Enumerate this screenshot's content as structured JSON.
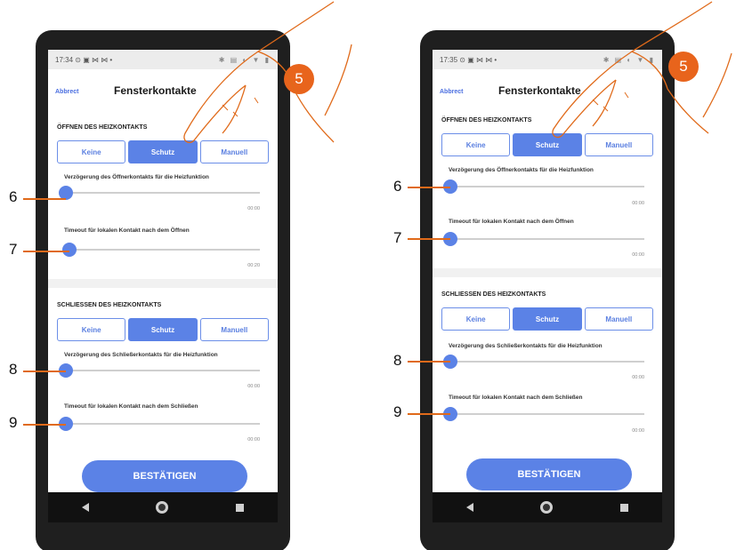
{
  "screens": [
    {
      "time": "17:34",
      "status_icons": "⊙ ▣ ⋈ ⋈ •",
      "status_right": "✱ ▤ ◐ ▼ ▮",
      "cancel": "Abbrect",
      "title": "Fensterkontakte",
      "open_section": "ÖFFNEN DES HEIZKONTAKTS",
      "open_buttons": [
        "Keine",
        "Schutz",
        "Manuell"
      ],
      "open_active": "Schutz",
      "slider1_label": "Verzögerung des Öffnerkontakts für die Heizfunktion",
      "slider1_value": "00:00",
      "slider2_label": "Timeout für lokalen Kontakt nach dem Öffnen",
      "slider2_value": "00:20",
      "close_section": "SCHLIESSEN DES HEIZKONTAKTS",
      "close_buttons": [
        "Keine",
        "Schutz",
        "Manuell"
      ],
      "close_active": "Schutz",
      "slider3_label": "Verzögerung des Schließerkontakts für die Heizfunktion",
      "slider3_value": "00:00",
      "slider4_label": "Timeout für lokalen Kontakt nach dem Schließen",
      "slider4_value": "00:00",
      "confirm": "BESTÄTIGEN"
    },
    {
      "time": "17:35",
      "status_icons": "⊙ ▣ ⋈ ⋈ •",
      "status_right": "✱ ▤ ◐ ▼ ▮",
      "cancel": "Abbrect",
      "title": "Fensterkontakte",
      "open_section": "ÖFFNEN DES HEIZKONTAKTS",
      "open_buttons": [
        "Keine",
        "Schutz",
        "Manuell"
      ],
      "open_active": "Schutz",
      "slider1_label": "Verzögerung des Öffnerkontakts für die Heizfunktion",
      "slider1_value": "00:00",
      "slider2_label": "Timeout für lokalen Kontakt nach dem Öffnen",
      "slider2_value": "00:00",
      "close_section": "SCHLIESSEN DES HEIZKONTAKTS",
      "close_buttons": [
        "Keine",
        "Schutz",
        "Manuell"
      ],
      "close_active": "Schutz",
      "slider3_label": "Verzögerung des Schließerkontakts für die Heizfunktion",
      "slider3_value": "00:00",
      "slider4_label": "Timeout für lokalen Kontakt nach dem Schließen",
      "slider4_value": "00:00",
      "confirm": "BESTÄTIGEN"
    }
  ],
  "callouts": {
    "left": [
      "6",
      "7",
      "8",
      "9"
    ],
    "right": [
      "6",
      "7",
      "8",
      "9"
    ],
    "step": "5"
  },
  "colors": {
    "accent": "#5b82e6",
    "callout": "#e8641c"
  }
}
